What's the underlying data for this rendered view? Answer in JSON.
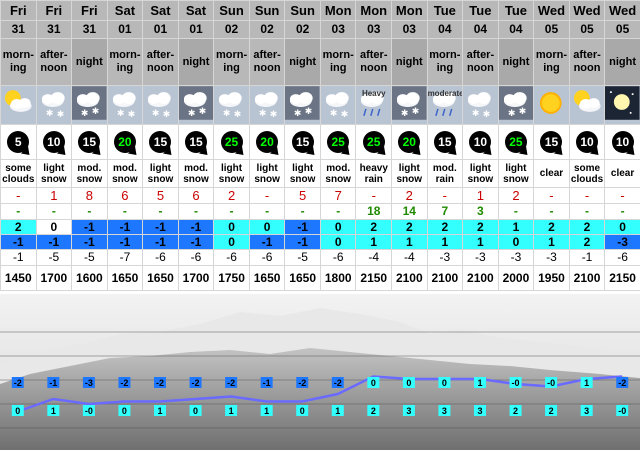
{
  "columns": [
    {
      "day": "Fri",
      "date": "31",
      "period": [
        "morn-",
        "ing"
      ],
      "icon": "sun-cloud-icon",
      "icon_label": "",
      "wind": "5",
      "wind_strong": false,
      "desc": [
        "some",
        "clouds"
      ],
      "snow": "-",
      "rain": "-",
      "t1": "2",
      "t1c": "cyan",
      "t2": "-1",
      "t2c": "blue",
      "t3": "-1",
      "fl": "1450",
      "pbot": "0",
      "ptop": "-2"
    },
    {
      "day": "Fri",
      "date": "31",
      "period": [
        "after-",
        "noon"
      ],
      "icon": "cloud-snow-icon",
      "icon_label": "",
      "wind": "10",
      "wind_strong": false,
      "desc": [
        "light",
        "snow"
      ],
      "snow": "1",
      "rain": "-",
      "t1": "0",
      "t1c": "",
      "t2": "-1",
      "t2c": "blue",
      "t3": "-5",
      "fl": "1700",
      "pbot": "1",
      "ptop": "-1"
    },
    {
      "day": "Fri",
      "date": "31",
      "period": [
        "night"
      ],
      "icon": "night-snow-icon",
      "icon_label": "",
      "wind": "15",
      "wind_strong": false,
      "desc": [
        "mod.",
        "snow"
      ],
      "snow": "8",
      "rain": "-",
      "t1": "-1",
      "t1c": "blue",
      "t2": "-1",
      "t2c": "blue",
      "t3": "-5",
      "fl": "1600",
      "pbot": "-0",
      "ptop": "-3"
    },
    {
      "day": "Sat",
      "date": "01",
      "period": [
        "morn-",
        "ing"
      ],
      "icon": "cloud-snow-icon",
      "icon_label": "",
      "wind": "20",
      "wind_strong": true,
      "desc": [
        "mod.",
        "snow"
      ],
      "snow": "6",
      "rain": "-",
      "t1": "-1",
      "t1c": "blue",
      "t2": "-1",
      "t2c": "blue",
      "t3": "-7",
      "fl": "1650",
      "pbot": "0",
      "ptop": "-2"
    },
    {
      "day": "Sat",
      "date": "01",
      "period": [
        "after-",
        "noon"
      ],
      "icon": "cloud-snow-icon",
      "icon_label": "",
      "wind": "15",
      "wind_strong": false,
      "desc": [
        "light",
        "snow"
      ],
      "snow": "5",
      "rain": "-",
      "t1": "-1",
      "t1c": "blue",
      "t2": "-1",
      "t2c": "blue",
      "t3": "-6",
      "fl": "1650",
      "pbot": "1",
      "ptop": "-2"
    },
    {
      "day": "Sat",
      "date": "01",
      "period": [
        "night"
      ],
      "icon": "night-snow-icon",
      "icon_label": "",
      "wind": "15",
      "wind_strong": false,
      "desc": [
        "mod.",
        "snow"
      ],
      "snow": "6",
      "rain": "-",
      "t1": "-1",
      "t1c": "blue",
      "t2": "-1",
      "t2c": "blue",
      "t3": "-6",
      "fl": "1700",
      "pbot": "0",
      "ptop": "-2"
    },
    {
      "day": "Sun",
      "date": "02",
      "period": [
        "morn-",
        "ing"
      ],
      "icon": "cloud-snow-icon",
      "icon_label": "",
      "wind": "25",
      "wind_strong": true,
      "desc": [
        "light",
        "snow"
      ],
      "snow": "2",
      "rain": "-",
      "t1": "0",
      "t1c": "cyan",
      "t2": "0",
      "t2c": "cyan",
      "t3": "-6",
      "fl": "1750",
      "pbot": "1",
      "ptop": "-2"
    },
    {
      "day": "Sun",
      "date": "02",
      "period": [
        "after-",
        "noon"
      ],
      "icon": "cloud-snow-icon",
      "icon_label": "",
      "wind": "20",
      "wind_strong": true,
      "desc": [
        "light",
        "snow"
      ],
      "snow": "-",
      "rain": "-",
      "t1": "0",
      "t1c": "cyan",
      "t2": "-1",
      "t2c": "blue",
      "t3": "-6",
      "fl": "1650",
      "pbot": "1",
      "ptop": "-1"
    },
    {
      "day": "Sun",
      "date": "02",
      "period": [
        "night"
      ],
      "icon": "night-snow-icon",
      "icon_label": "",
      "wind": "15",
      "wind_strong": false,
      "desc": [
        "light",
        "snow"
      ],
      "snow": "5",
      "rain": "-",
      "t1": "-1",
      "t1c": "blue",
      "t2": "-1",
      "t2c": "blue",
      "t3": "-5",
      "fl": "1650",
      "pbot": "0",
      "ptop": "-2"
    },
    {
      "day": "Mon",
      "date": "03",
      "period": [
        "morn-",
        "ing"
      ],
      "icon": "cloud-snow-icon",
      "icon_label": "",
      "wind": "25",
      "wind_strong": true,
      "desc": [
        "mod.",
        "snow"
      ],
      "snow": "7",
      "rain": "-",
      "t1": "0",
      "t1c": "cyan",
      "t2": "0",
      "t2c": "cyan",
      "t3": "-6",
      "fl": "1800",
      "pbot": "1",
      "ptop": "-2"
    },
    {
      "day": "Mon",
      "date": "03",
      "period": [
        "after-",
        "noon"
      ],
      "icon": "cloud-rain-icon",
      "icon_label": "Heavy",
      "wind": "25",
      "wind_strong": true,
      "desc": [
        "heavy",
        "rain"
      ],
      "snow": "-",
      "rain": "18",
      "t1": "2",
      "t1c": "cyan",
      "t2": "1",
      "t2c": "cyan",
      "t3": "-4",
      "fl": "2150",
      "pbot": "2",
      "ptop": "0"
    },
    {
      "day": "Mon",
      "date": "03",
      "period": [
        "night"
      ],
      "icon": "night-snow-icon",
      "icon_label": "",
      "wind": "20",
      "wind_strong": true,
      "desc": [
        "light",
        "snow"
      ],
      "snow": "2",
      "rain": "14",
      "t1": "2",
      "t1c": "cyan",
      "t2": "1",
      "t2c": "cyan",
      "t3": "-4",
      "fl": "2100",
      "pbot": "3",
      "ptop": "0"
    },
    {
      "day": "Tue",
      "date": "04",
      "period": [
        "morn-",
        "ing"
      ],
      "icon": "cloud-rain-icon",
      "icon_label": "moderate",
      "wind": "15",
      "wind_strong": false,
      "desc": [
        "mod.",
        "rain"
      ],
      "snow": "-",
      "rain": "7",
      "t1": "2",
      "t1c": "cyan",
      "t2": "1",
      "t2c": "cyan",
      "t3": "-3",
      "fl": "2100",
      "pbot": "3",
      "ptop": "0"
    },
    {
      "day": "Tue",
      "date": "04",
      "period": [
        "after-",
        "noon"
      ],
      "icon": "cloud-snow-icon",
      "icon_label": "",
      "wind": "10",
      "wind_strong": false,
      "desc": [
        "light",
        "snow"
      ],
      "snow": "1",
      "rain": "3",
      "t1": "2",
      "t1c": "cyan",
      "t2": "1",
      "t2c": "cyan",
      "t3": "-3",
      "fl": "2100",
      "pbot": "3",
      "ptop": "1"
    },
    {
      "day": "Tue",
      "date": "04",
      "period": [
        "night"
      ],
      "icon": "night-snow-icon",
      "icon_label": "",
      "wind": "25",
      "wind_strong": true,
      "desc": [
        "light",
        "snow"
      ],
      "snow": "2",
      "rain": "-",
      "t1": "1",
      "t1c": "cyan",
      "t2": "0",
      "t2c": "cyan",
      "t3": "-3",
      "fl": "2000",
      "pbot": "2",
      "ptop": "-0"
    },
    {
      "day": "Wed",
      "date": "05",
      "period": [
        "morn-",
        "ing"
      ],
      "icon": "sun-icon",
      "icon_label": "",
      "wind": "15",
      "wind_strong": false,
      "desc": [
        "clear"
      ],
      "snow": "-",
      "rain": "-",
      "t1": "2",
      "t1c": "cyan",
      "t2": "1",
      "t2c": "cyan",
      "t3": "-3",
      "fl": "1950",
      "pbot": "2",
      "ptop": "-0"
    },
    {
      "day": "Wed",
      "date": "05",
      "period": [
        "after-",
        "noon"
      ],
      "icon": "sun-cloud-icon",
      "icon_label": "",
      "wind": "10",
      "wind_strong": false,
      "desc": [
        "some",
        "clouds"
      ],
      "snow": "-",
      "rain": "-",
      "t1": "2",
      "t1c": "cyan",
      "t2": "2",
      "t2c": "cyan",
      "t3": "-1",
      "fl": "2100",
      "pbot": "3",
      "ptop": "1"
    },
    {
      "day": "Wed",
      "date": "05",
      "period": [
        "night"
      ],
      "icon": "moon-icon",
      "icon_label": "",
      "wind": "10",
      "wind_strong": false,
      "desc": [
        "clear"
      ],
      "snow": "-",
      "rain": "-",
      "t1": "0",
      "t1c": "cyan",
      "t2": "-3",
      "t2c": "blue",
      "t3": "-6",
      "fl": "2150",
      "pbot": "-0",
      "ptop": "-2"
    }
  ],
  "colors": {
    "header_bg": "#b8b8b8",
    "icon_bg": "#b9c4d3",
    "cyan": "#33ffff",
    "blue": "#1e78ff",
    "snow": "#cc0000",
    "rain": "#1f8a00",
    "freezing_line": "#6a6aff"
  }
}
